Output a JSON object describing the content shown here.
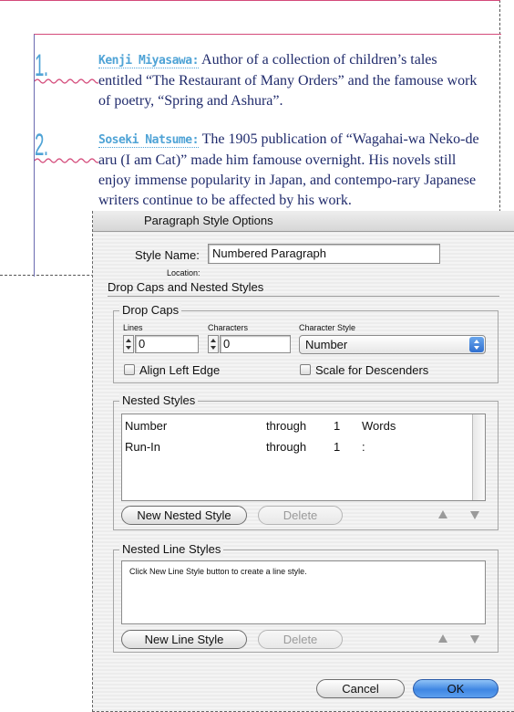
{
  "document": {
    "items": [
      {
        "number": "1.",
        "runin": "Kenji Miyasawa:",
        "text": " Author of a collection of children’s tales entitled “The Restaurant of Many Orders” and the famouse work of poetry, “Spring and Ashura”."
      },
      {
        "number": "2.",
        "runin": "Soseki Natsume:",
        "text": " The 1905 publication of “Wagahai-wa Neko-de aru (I am Cat)” made him famouse overnight. His novels still enjoy immense popularity in Japan, and contempo-rary Japanese writers continue to be affected by his work."
      }
    ]
  },
  "dialog": {
    "title": "Paragraph Style Options",
    "style_name_label": "Style Name:",
    "style_name_value": "Numbered Paragraph",
    "location_label": "Location:",
    "section_title": "Drop Caps and Nested Styles",
    "drop_caps": {
      "title": "Drop Caps",
      "lines_label": "Lines",
      "lines_value": "0",
      "characters_label": "Characters",
      "characters_value": "0",
      "char_style_label": "Character Style",
      "char_style_value": "Number",
      "align_left_edge": "Align Left Edge",
      "scale_for_descenders": "Scale for Descenders"
    },
    "nested_styles": {
      "title": "Nested Styles",
      "rows": [
        {
          "style": "Number",
          "mode": "through",
          "count": "1",
          "unit": "Words"
        },
        {
          "style": "Run-In",
          "mode": "through",
          "count": "1",
          "unit": ":"
        }
      ],
      "new_button": "New Nested Style",
      "delete_button": "Delete"
    },
    "nested_line_styles": {
      "title": "Nested Line Styles",
      "hint": "Click New Line Style button to create a line style.",
      "new_button": "New Line Style",
      "delete_button": "Delete"
    },
    "cancel_button": "Cancel",
    "ok_button": "OK"
  }
}
